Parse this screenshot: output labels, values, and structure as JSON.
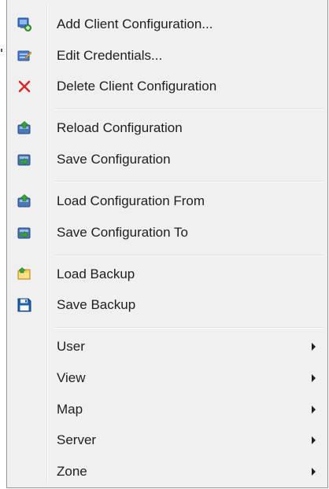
{
  "menu": {
    "items": [
      {
        "label": "Add Client Configuration...",
        "icon": "add-client-icon"
      },
      {
        "label": "Edit Credentials...",
        "icon": "edit-credentials-icon"
      },
      {
        "label": "Delete Client Configuration",
        "icon": "delete-x-icon"
      },
      {
        "label": "Reload Configuration",
        "icon": "reload-config-icon"
      },
      {
        "label": "Save Configuration",
        "icon": "save-config-icon"
      },
      {
        "label": "Load Configuration From",
        "icon": "load-config-from-icon"
      },
      {
        "label": "Save Configuration To",
        "icon": "save-config-to-icon"
      },
      {
        "label": "Load Backup",
        "icon": "load-backup-folder-icon"
      },
      {
        "label": "Save Backup",
        "icon": "floppy-disk-icon"
      },
      {
        "label": "User",
        "submenu": true
      },
      {
        "label": "View",
        "submenu": true
      },
      {
        "label": "Map",
        "submenu": true
      },
      {
        "label": "Server",
        "submenu": true
      },
      {
        "label": "Zone",
        "submenu": true
      }
    ]
  },
  "colors": {
    "menu_background": "#f0f0f0",
    "border": "#979797",
    "text": "#1e1e1e",
    "delete_red": "#d42a2a",
    "floppy_blue": "#1f5fb0"
  }
}
